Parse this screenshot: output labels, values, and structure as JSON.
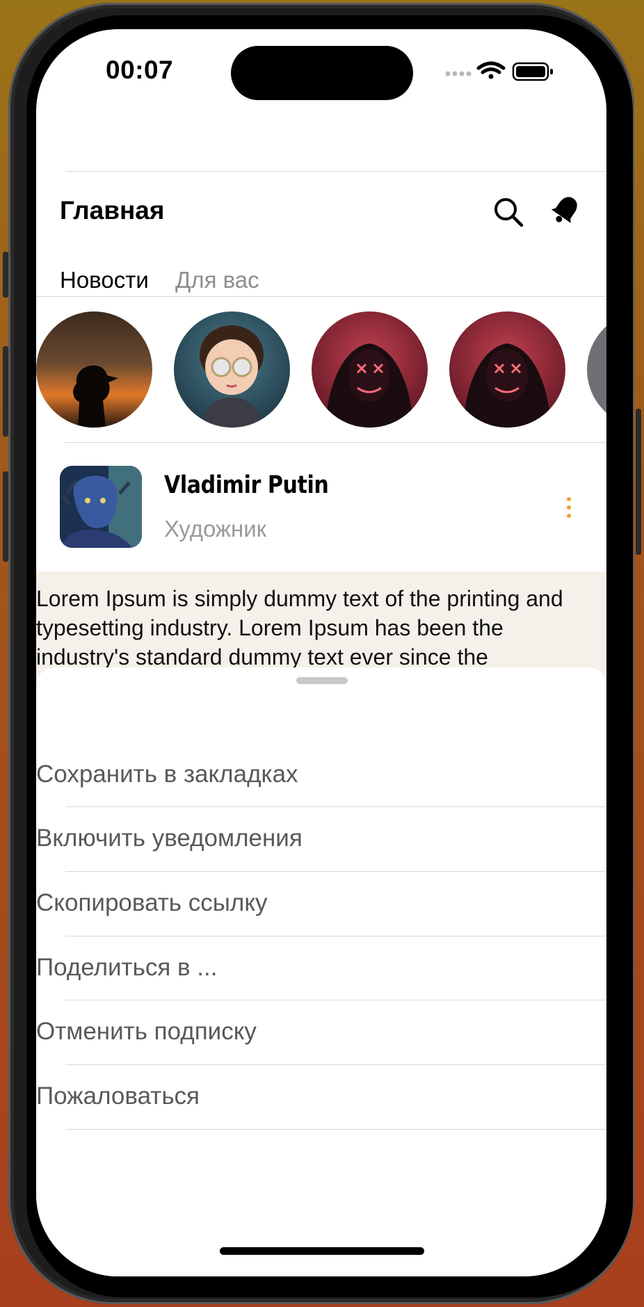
{
  "status_bar": {
    "time": "00:07"
  },
  "header": {
    "title": "Главная"
  },
  "tabs": [
    {
      "label": "Новости",
      "active": true
    },
    {
      "label": "Для вас",
      "active": false
    }
  ],
  "stories": [
    {
      "name": "story-1"
    },
    {
      "name": "story-2"
    },
    {
      "name": "story-3"
    },
    {
      "name": "story-4"
    },
    {
      "name": "story-5"
    }
  ],
  "post": {
    "author": "Vladimir Putin",
    "role": "Художник",
    "text": "Lorem Ipsum is simply dummy text of the printing and typesetting industry. Lorem Ipsum has been the industry's standard dummy text ever since the"
  },
  "sheet": {
    "items": [
      {
        "label": "Сохранить в закладках"
      },
      {
        "label": "Включить уведомления"
      },
      {
        "label": "Скопировать ссылку"
      },
      {
        "label": "Поделиться в ..."
      },
      {
        "label": "Отменить подписку"
      },
      {
        "label": "Пожаловаться"
      }
    ]
  },
  "colors": {
    "accent": "#f0a030",
    "menu_text": "#595959",
    "post_bg": "#f5f0ea"
  }
}
